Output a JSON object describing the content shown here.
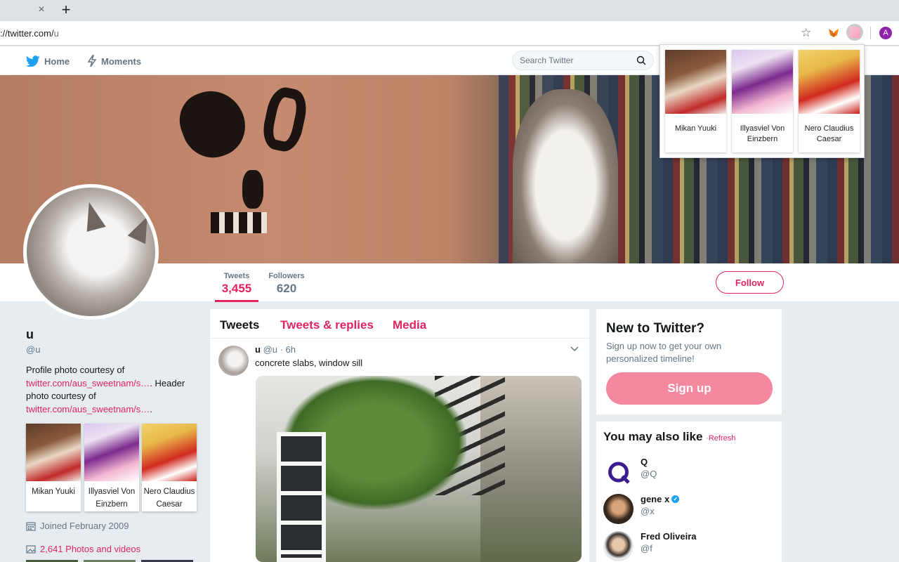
{
  "browser": {
    "url_host": "://twitter.com/",
    "url_path": "u",
    "tab_close": "×",
    "new_tab": "+",
    "account_initial": "A"
  },
  "nav": {
    "home_label": "Home",
    "moments_label": "Moments",
    "search_placeholder": "Search Twitter"
  },
  "popup": {
    "items": [
      {
        "name": "Mikan Yuuki"
      },
      {
        "name": "Illyasviel Von Einzbern"
      },
      {
        "name": "Nero Claudius Caesar"
      }
    ]
  },
  "profile_nav": {
    "tweets_label": "Tweets",
    "tweets_count": "3,455",
    "followers_label": "Followers",
    "followers_count": "620",
    "follow_label": "Follow"
  },
  "profile": {
    "name": "u",
    "handle": "@u",
    "bio_1": "Profile photo courtesy of",
    "bio_link_1": "twitter.com/aus_sweetnam/s…",
    "bio_2": ". Header photo courtesy of",
    "bio_link_2": "twitter.com/aus_sweetnam/s…",
    "bio_3": ".",
    "characters": [
      {
        "name": "Mikan Yuuki"
      },
      {
        "name": "Illyasviel Von Einzbern"
      },
      {
        "name": "Nero Claudius Caesar"
      }
    ],
    "joined": "Joined February 2009",
    "photos": "2,641 Photos and videos"
  },
  "timeline": {
    "tabs": [
      "Tweets",
      "Tweets & replies",
      "Media"
    ],
    "tweet": {
      "author": "u",
      "meta": "@u · 6h",
      "text": "concrete slabs, window sill"
    }
  },
  "signup": {
    "title": "New to Twitter?",
    "text": "Sign up now to get your own personalized timeline!",
    "button": "Sign up"
  },
  "wtf": {
    "title": "You may also like",
    "separator": "·",
    "refresh": "Refresh",
    "users": [
      {
        "name": "Q",
        "handle": "@Q",
        "verified": false
      },
      {
        "name": "gene x",
        "handle": "@x",
        "verified": true
      },
      {
        "name": "Fred Oliveira",
        "handle": "@f",
        "verified": false
      }
    ]
  },
  "colors": {
    "accent": "#e0245e",
    "signup_button": "#f4889f",
    "verified": "#1da1f2"
  }
}
